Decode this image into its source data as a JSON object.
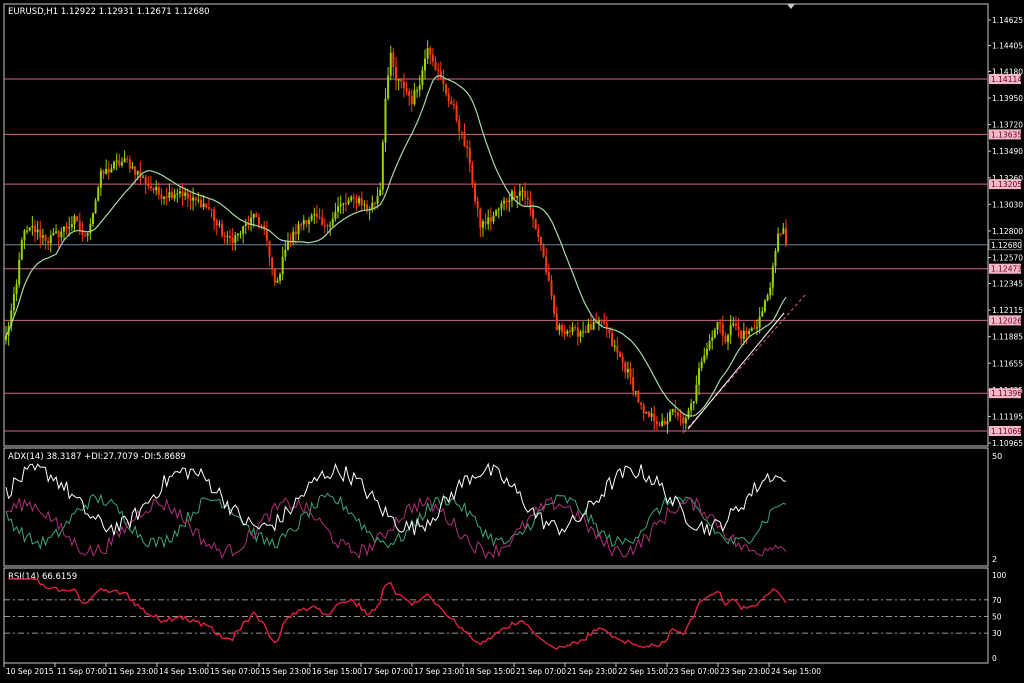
{
  "window_title": "EURUSD,H1  1.12922 1.12931 1.12671 1.12680",
  "colors": {
    "background": "#000000",
    "frame": "#c8c8c8",
    "bull": "#9bd400",
    "bear": "#ff3a12",
    "ma": "#a8d8a8",
    "hline": "#d06a8a",
    "adx": "#ffffff",
    "plus_di": "#3aa878",
    "minus_di": "#b0307a",
    "rsi": "#e02040"
  },
  "chart_data": [
    {
      "type": "candlestick",
      "title": "EURUSD,H1  1.12922 1.12931 1.12671 1.12680",
      "symbol": "EURUSD",
      "timeframe": "H1",
      "ohlc_current": {
        "open": 1.12922,
        "high": 1.12931,
        "low": 1.12671,
        "close": 1.1268
      },
      "y_ticks": [
        "1.14625",
        "1.14405",
        "1.14180",
        "1.13950",
        "1.13720",
        "1.13490",
        "1.13260",
        "1.13030",
        "1.12800",
        "1.12570",
        "1.12345",
        "1.12115",
        "1.11885",
        "1.11655",
        "1.11425",
        "1.11195",
        "1.10965"
      ],
      "ylim": [
        1.10965,
        1.14625
      ],
      "x_ticks": [
        "10 Sep 2015",
        "11 Sep 07:00",
        "11 Sep 23:00",
        "14 Sep 15:00",
        "15 Sep 07:00",
        "15 Sep 23:00",
        "16 Sep 15:00",
        "17 Sep 07:00",
        "17 Sep 23:00",
        "18 Sep 15:00",
        "21 Sep 07:00",
        "21 Sep 23:00",
        "22 Sep 15:00",
        "23 Sep 07:00",
        "23 Sep 23:00",
        "24 Sep 15:00"
      ],
      "horizontal_levels": [
        "1.14114",
        "1.13635",
        "1.13205",
        "1.12473",
        "1.12026",
        "1.11396",
        "1.11069"
      ],
      "price_label": "1.12680",
      "price_anchors": [
        [
          0,
          1.1188
        ],
        [
          4,
          1.1232
        ],
        [
          6,
          1.1275
        ],
        [
          10,
          1.1282
        ],
        [
          16,
          1.1272
        ],
        [
          20,
          1.1278
        ],
        [
          26,
          1.1289
        ],
        [
          30,
          1.1273
        ],
        [
          33,
          1.1297
        ],
        [
          36,
          1.1328
        ],
        [
          42,
          1.1338
        ],
        [
          46,
          1.134
        ],
        [
          50,
          1.133
        ],
        [
          54,
          1.132
        ],
        [
          58,
          1.1312
        ],
        [
          62,
          1.1312
        ],
        [
          66,
          1.1315
        ],
        [
          70,
          1.1306
        ],
        [
          74,
          1.1305
        ],
        [
          78,
          1.1297
        ],
        [
          80,
          1.1285
        ],
        [
          84,
          1.1272
        ],
        [
          88,
          1.1276
        ],
        [
          92,
          1.1287
        ],
        [
          95,
          1.1292
        ],
        [
          98,
          1.128
        ],
        [
          101,
          1.1245
        ],
        [
          103,
          1.1233
        ],
        [
          105,
          1.126
        ],
        [
          109,
          1.1276
        ],
        [
          113,
          1.129
        ],
        [
          117,
          1.1292
        ],
        [
          121,
          1.1282
        ],
        [
          126,
          1.13
        ],
        [
          130,
          1.1305
        ],
        [
          134,
          1.1308
        ],
        [
          137,
          1.1298
        ],
        [
          140,
          1.1305
        ],
        [
          142,
          1.1318
        ],
        [
          144,
          1.1398
        ],
        [
          146,
          1.143
        ],
        [
          148,
          1.141
        ],
        [
          151,
          1.1405
        ],
        [
          154,
          1.1393
        ],
        [
          156,
          1.1403
        ],
        [
          158,
          1.1418
        ],
        [
          160,
          1.1442
        ],
        [
          162,
          1.143
        ],
        [
          164,
          1.1416
        ],
        [
          167,
          1.14
        ],
        [
          170,
          1.1385
        ],
        [
          173,
          1.1362
        ],
        [
          176,
          1.134
        ],
        [
          178,
          1.1305
        ],
        [
          180,
          1.1285
        ],
        [
          184,
          1.129
        ],
        [
          188,
          1.1302
        ],
        [
          192,
          1.1312
        ],
        [
          196,
          1.1315
        ],
        [
          198,
          1.1305
        ],
        [
          200,
          1.129
        ],
        [
          203,
          1.1268
        ],
        [
          205,
          1.1246
        ],
        [
          207,
          1.122
        ],
        [
          209,
          1.1195
        ],
        [
          212,
          1.1195
        ],
        [
          216,
          1.1192
        ],
        [
          220,
          1.1195
        ],
        [
          224,
          1.1198
        ],
        [
          227,
          1.12
        ],
        [
          230,
          1.1182
        ],
        [
          233,
          1.117
        ],
        [
          236,
          1.1157
        ],
        [
          239,
          1.114
        ],
        [
          242,
          1.112
        ],
        [
          246,
          1.1118
        ],
        [
          250,
          1.111
        ],
        [
          252,
          1.1125
        ],
        [
          255,
          1.1118
        ],
        [
          258,
          1.1115
        ],
        [
          261,
          1.1135
        ],
        [
          263,
          1.1165
        ],
        [
          266,
          1.1178
        ],
        [
          268,
          1.1192
        ],
        [
          270,
          1.12
        ],
        [
          273,
          1.1188
        ],
        [
          276,
          1.12
        ],
        [
          279,
          1.119
        ],
        [
          282,
          1.1192
        ],
        [
          285,
          1.12
        ],
        [
          287,
          1.121
        ],
        [
          289,
          1.1225
        ],
        [
          291,
          1.1245
        ],
        [
          293,
          1.1275
        ],
        [
          295,
          1.1285
        ],
        [
          296,
          1.1268
        ]
      ],
      "ma_period": 20
    },
    {
      "type": "line",
      "title": "ADX(14) 38.3187 +DI:27.7079 -DI:5.8689",
      "series": [
        {
          "name": "ADX(14)",
          "last": 38.3187
        },
        {
          "name": "+DI",
          "last": 27.7079
        },
        {
          "name": "-DI",
          "last": 5.8689
        }
      ],
      "y_ticks": [
        "50",
        "2"
      ],
      "ylim": [
        2,
        50
      ]
    },
    {
      "type": "line",
      "title": "RSI(14) 66.6159",
      "series": [
        {
          "name": "RSI(14)",
          "last": 66.6159
        }
      ],
      "y_ticks": [
        "100",
        "70",
        "50",
        "30",
        "0"
      ],
      "levels": [
        70,
        50,
        30
      ],
      "ylim": [
        0,
        100
      ]
    }
  ]
}
